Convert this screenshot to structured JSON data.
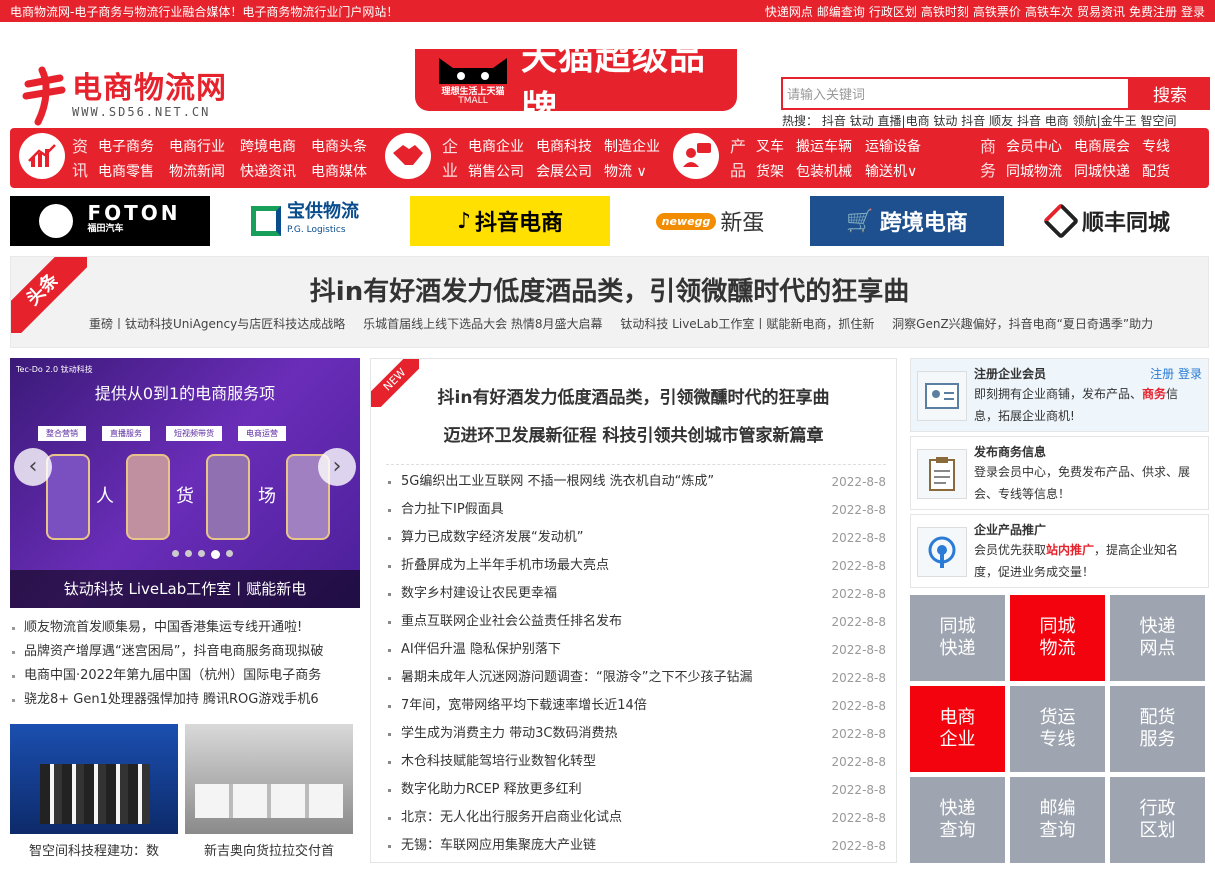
{
  "topbar": {
    "left": "电商物流网-电子商务与物流行业融合媒体！电子商务物流行业门户网站！",
    "links": [
      "快递网点",
      "邮编查询",
      "行政区划",
      "高铁时刻",
      "高铁票价",
      "高铁车次",
      "贸易资讯",
      "免费注册",
      "登录"
    ]
  },
  "logo": {
    "name": "电商物流网",
    "url": "WWW.SD56.NET.CN"
  },
  "tmall": {
    "slogan": "理想生活上天猫",
    "sub": "TMALL",
    "brand": "天猫超级品牌"
  },
  "search": {
    "placeholder": "请输入关键词",
    "button": "搜索"
  },
  "hot": {
    "label": "热搜：",
    "items": [
      "抖音",
      "钛动",
      "直播|电商",
      "钛动",
      "抖音",
      "顺友",
      "抖音",
      "电商",
      "领航|金牛王",
      "智空间"
    ]
  },
  "nav": {
    "g1": {
      "label": "资讯",
      "row1": [
        "电子商务",
        "电商行业",
        "跨境电商",
        "电商头条"
      ],
      "row2": [
        "电商零售",
        "物流新闻",
        "快递资讯",
        "电商媒体"
      ]
    },
    "g2": {
      "label": "企业",
      "row1": [
        "电商企业",
        "电商科技",
        "制造企业"
      ],
      "row2": [
        "销售公司",
        "会展公司",
        "物流 ∨"
      ]
    },
    "g3": {
      "label": "产品",
      "row1": [
        "叉车",
        "搬运车辆",
        "运输设备"
      ],
      "row2": [
        "货架",
        "包装机械",
        "输送机∨"
      ]
    },
    "g4": {
      "label": "商务",
      "row1": [
        "会员中心",
        "电商展会",
        "专线"
      ],
      "row2": [
        "同城物流",
        "同城快递",
        "配货"
      ]
    }
  },
  "logos": {
    "foton": "FOTON",
    "foton_sub": "福田汽车",
    "baogong": "宝供物流",
    "baogong_sub": "P.G. Logistics",
    "douyin": "抖音电商",
    "newegg": "newegg",
    "newegg_cn": "新蛋",
    "kuajing": "跨境电商",
    "shunfeng": "顺丰同城"
  },
  "headline": {
    "tag": "头条",
    "title": "抖in有好酒发力低度酒品类，引领微醺时代的狂享曲",
    "subs": [
      "重磅丨钛动科技UniAgency与店匠科技达成战略",
      "乐城首届线上线下选品大会 热情8月盛大启幕",
      "钛动科技 LiveLab工作室丨赋能新电商，抓住新",
      "洞察GenZ兴趣偏好，抖音电商“夏日奇遇季”助力"
    ]
  },
  "slider": {
    "top": "Tec-Do 2.0 钛动科技",
    "heading": "提供从0到1的电商服务项",
    "tabs": [
      "整合营销",
      "直播服务",
      "短视频带货",
      "电商运营"
    ],
    "chars": [
      "人",
      "货",
      "场"
    ],
    "caption": "钛动科技 LiveLab工作室丨赋能新电"
  },
  "leftlist": [
    "顺友物流首发顺集易，中国香港集运专线开通啦!",
    "品牌资产增厚遇“迷宫困局”，抖音电商服务商现拟破",
    "电商中国·2022年第九届中国（杭州）国际电子商务",
    "骁龙8+ Gen1处理器强悍加持 腾讯ROG游戏手机6"
  ],
  "thumbs": [
    {
      "caption": "智空间科技程建功：数"
    },
    {
      "caption": "新吉奥向货拉拉交付首"
    }
  ],
  "center": {
    "newtag": "NEW",
    "h1": "抖in有好酒发力低度酒品类，引领微醺时代的狂享曲",
    "h2": "迈进环卫发展新征程 科技引领共创城市管家新篇章",
    "news": [
      {
        "t": "5G编织出工业互联网 不插一根网线 洗衣机自动“炼成”",
        "d": "2022-8-8"
      },
      {
        "t": "合力扯下IP假面具",
        "d": "2022-8-8"
      },
      {
        "t": "算力已成数字经济发展“发动机”",
        "d": "2022-8-8"
      },
      {
        "t": "折叠屏成为上半年手机市场最大亮点",
        "d": "2022-8-8"
      },
      {
        "t": "数字乡村建设让农民更幸福",
        "d": "2022-8-8"
      },
      {
        "t": "重点互联网企业社会公益责任排名发布",
        "d": "2022-8-8"
      },
      {
        "t": "AI伴侣升温 隐私保护别落下",
        "d": "2022-8-8"
      },
      {
        "t": "暑期未成年人沉迷网游问题调查：“限游令”之下不少孩子钻漏",
        "d": "2022-8-8"
      },
      {
        "t": "7年间，宽带网络平均下载速率增长近14倍",
        "d": "2022-8-8"
      },
      {
        "t": "学生成为消费主力 带动3C数码消费热",
        "d": "2022-8-8"
      },
      {
        "t": "木仓科技赋能驾培行业数智化转型",
        "d": "2022-8-8"
      },
      {
        "t": "数字化助力RCEP 释放更多红利",
        "d": "2022-8-8"
      },
      {
        "t": "北京：无人化出行服务开启商业化试点",
        "d": "2022-8-8"
      },
      {
        "t": "无锡：车联网应用集聚庞大产业链",
        "d": "2022-8-8"
      }
    ]
  },
  "cards": [
    {
      "title": "注册企业会员",
      "desc_a": "即刻拥有企业商铺，发布产品、",
      "desc_hl": "商务",
      "desc_b": "信息，拓展企业商机!",
      "link_reg": "注册",
      "link_login": "登录"
    },
    {
      "title": "发布商务信息",
      "desc": "登录会员中心，免费发布产品、供求、展会、专线等信息！"
    },
    {
      "title": "企业产品推广",
      "desc_a": "会员优先获取",
      "desc_hl": "站内推广",
      "desc_b": "，提高企业知名度，促进业务成交量！"
    }
  ],
  "grid": [
    {
      "l1": "同城",
      "l2": "快递",
      "c": "gray"
    },
    {
      "l1": "同城",
      "l2": "物流",
      "c": "red"
    },
    {
      "l1": "快递",
      "l2": "网点",
      "c": "gray"
    },
    {
      "l1": "电商",
      "l2": "企业",
      "c": "red"
    },
    {
      "l1": "货运",
      "l2": "专线",
      "c": "gray"
    },
    {
      "l1": "配货",
      "l2": "服务",
      "c": "gray"
    },
    {
      "l1": "快递",
      "l2": "查询",
      "c": "gray"
    },
    {
      "l1": "邮编",
      "l2": "查询",
      "c": "gray"
    },
    {
      "l1": "行政",
      "l2": "区划",
      "c": "gray"
    }
  ],
  "colors": {
    "brand": "#e6232d",
    "grid_red": "#f2030d",
    "grid_gray": "#9ea5b0",
    "link": "#2a7bd6"
  }
}
